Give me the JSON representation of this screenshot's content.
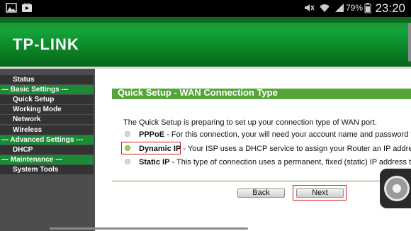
{
  "statusbar": {
    "icons": [
      "image-icon",
      "play-store-icon",
      "mute-icon",
      "wifi-icon",
      "signal-icon",
      "battery-icon"
    ],
    "battery": "79%",
    "time": "23:20"
  },
  "header": {
    "logo": "TP-LINK",
    "brand_color": "#13a33a"
  },
  "sidebar": {
    "items": [
      {
        "label": "Status",
        "type": "item"
      },
      {
        "label": "--- Basic Settings ---",
        "type": "group"
      },
      {
        "label": "Quick Setup",
        "type": "item"
      },
      {
        "label": "Working Mode",
        "type": "item"
      },
      {
        "label": "Network",
        "type": "item"
      },
      {
        "label": "Wireless",
        "type": "item"
      },
      {
        "label": "--- Advanced Settings ---",
        "type": "group"
      },
      {
        "label": "DHCP",
        "type": "item"
      },
      {
        "label": "--- Maintenance ---",
        "type": "group"
      },
      {
        "label": "System Tools",
        "type": "item"
      }
    ]
  },
  "main": {
    "title": "Quick Setup - WAN Connection Type",
    "intro": "The Quick Setup is preparing to set up your connection type of WAN port.",
    "options": [
      {
        "label": "PPPoE",
        "desc": " - For this connection, your will need your account name and password fr",
        "selected": false
      },
      {
        "label": "Dynamic IP",
        "desc": " - Your ISP uses a DHCP service to assign your Router an IP addres",
        "selected": true
      },
      {
        "label": "Static IP",
        "desc": " - This type of connection uses a permanent, fixed (static) IP address th",
        "selected": false
      }
    ],
    "buttons": {
      "back": "Back",
      "next": "Next"
    },
    "highlight_color": "#d21b1b"
  }
}
